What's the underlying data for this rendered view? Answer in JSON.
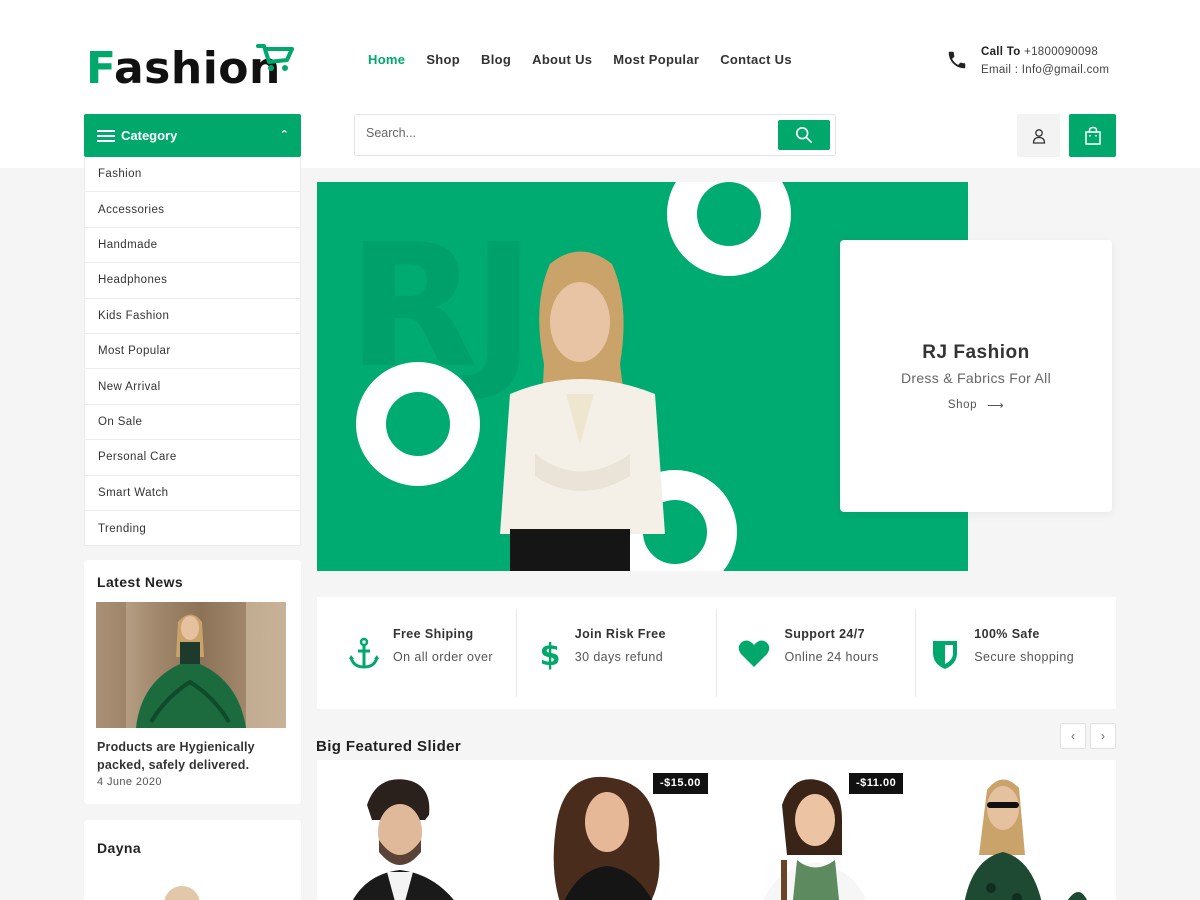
{
  "brand": {
    "name_first": "F",
    "name_rest": "ashion"
  },
  "nav": {
    "items": [
      "Home",
      "Shop",
      "Blog",
      "About Us",
      "Most Popular",
      "Contact Us"
    ],
    "active": "Home"
  },
  "contact": {
    "call_label": "Call To",
    "phone": "+1800090098",
    "email_label": "Email :",
    "email": "Info@gmail.com"
  },
  "category": {
    "label": "Category",
    "items": [
      "Fashion",
      "Accessories",
      "Handmade",
      "Headphones",
      "Kids Fashion",
      "Most Popular",
      "New Arrival",
      "On Sale",
      "Personal Care",
      "Smart Watch",
      "Trending"
    ]
  },
  "search": {
    "placeholder": "Search..."
  },
  "hero": {
    "watermark": "RJ",
    "title": "RJ Fashion",
    "subtitle": "Dress & Fabrics For All",
    "link_label": "Shop"
  },
  "features": [
    {
      "icon": "anchor-icon",
      "title": "Free Shiping",
      "subtitle": "On all order over"
    },
    {
      "icon": "dollar-icon",
      "title": "Join Risk Free",
      "subtitle": "30 days refund"
    },
    {
      "icon": "heart-icon",
      "title": "Support 24/7",
      "subtitle": "Online 24 hours"
    },
    {
      "icon": "shield-icon",
      "title": "100% Safe",
      "subtitle": "Secure shopping"
    }
  ],
  "latest_news": {
    "heading": "Latest News",
    "title": "Products are Hygienically packed, safely delivered.",
    "date": "4 June 2020"
  },
  "sidebar_widget": {
    "heading": "Dayna"
  },
  "featured": {
    "heading": "Big Featured Slider",
    "products": [
      {
        "price_badge": ""
      },
      {
        "price_badge": "-$15.00"
      },
      {
        "price_badge": "-$11.00"
      },
      {
        "price_badge": ""
      }
    ]
  },
  "colors": {
    "accent": "#00a86b",
    "hero_bg": "#00ab72",
    "page_bg": "#f5f5f5",
    "badge_bg": "#111111"
  }
}
